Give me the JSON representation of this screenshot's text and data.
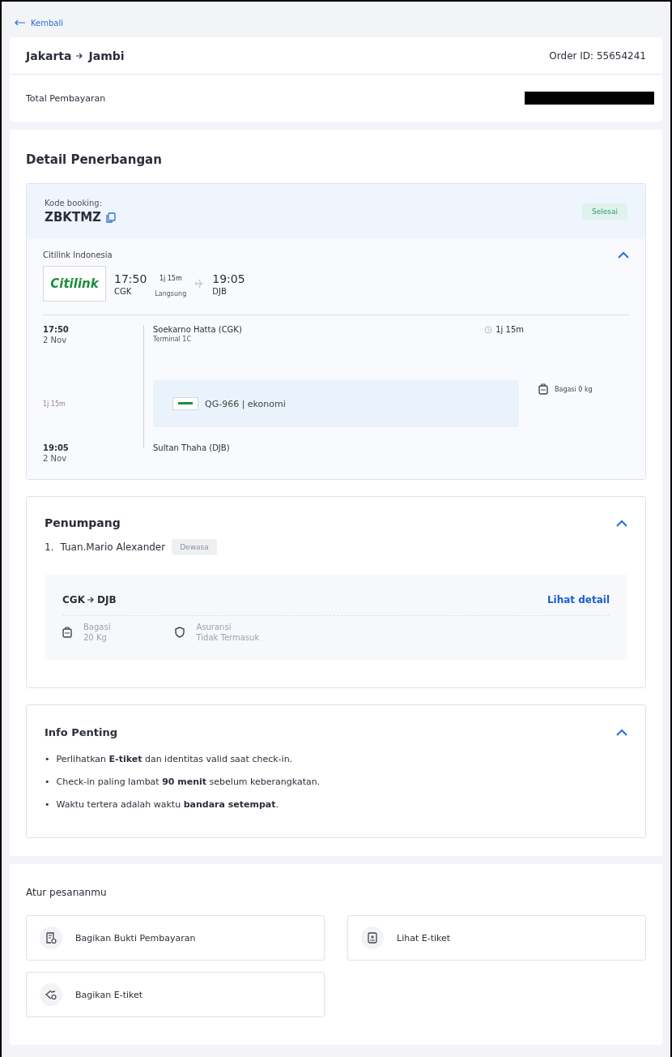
{
  "back_link": "Kembali",
  "header": {
    "route_from": "Jakarta",
    "route_to": "Jambi",
    "order_id": "Order ID: 55654241",
    "total_label": "Total Pembayaran"
  },
  "flight_detail": {
    "title": "Detail Penerbangan",
    "booking_label": "Kode booking:",
    "booking_code": "ZBKTMZ",
    "status": "Selesai",
    "airline": "Citilink Indonesia",
    "expanded": true,
    "airline_logo": "Citilink",
    "summary": {
      "depart_time": "17:50",
      "depart_code": "CGK",
      "duration": "1j 15m",
      "stops": "Langsung",
      "arrive_time": "19:05",
      "arrive_code": "DJB"
    },
    "segment": {
      "depart_time": "17:50",
      "depart_date": "2 Nov",
      "depart_airport": "Soekarno Hatta (CGK)",
      "terminal": "Terminal 1C",
      "duration": "1j 15m",
      "leg_duration": "1j 15m",
      "flight": "QG-966 | ekonomi",
      "baggage": "Bagasi 0 kg",
      "arrive_time": "19:05",
      "arrive_date": "2 Nov",
      "arrive_airport": "Sultan Thaha (DJB)"
    }
  },
  "passengers": {
    "title": "Penumpang",
    "expanded": true,
    "items": [
      {
        "number": "1.",
        "name": "Tuan.Mario Alexander",
        "type": "Dewasa"
      }
    ],
    "route": {
      "from": "CGK",
      "to": "DJB",
      "link": "Lihat detail",
      "baggage_label": "Bagasi",
      "baggage_value": "20 Kg",
      "insurance_label": "Asuransi",
      "insurance_value": "Tidak Termasuk"
    }
  },
  "info": {
    "title": "Info Penting",
    "expanded": true,
    "items": [
      {
        "marker": "•",
        "text": "Perlihatkan **E-tiket** dan identitas valid saat check-in."
      },
      {
        "marker": "•",
        "text": "Check-in paling lambat **90 menit** sebelum keberangkatan."
      },
      {
        "marker": "•",
        "text": "Waktu tertera adalah waktu **bandara setempat**."
      }
    ]
  },
  "manage": {
    "title": "Atur pesananmu",
    "actions": [
      {
        "kind": "receipt",
        "label": "Bagikan Bukti Pembayaran"
      },
      {
        "kind": "ticket",
        "label": "Lihat E-tiket"
      },
      {
        "kind": "share",
        "label": "Bagikan E-tiket"
      }
    ]
  }
}
